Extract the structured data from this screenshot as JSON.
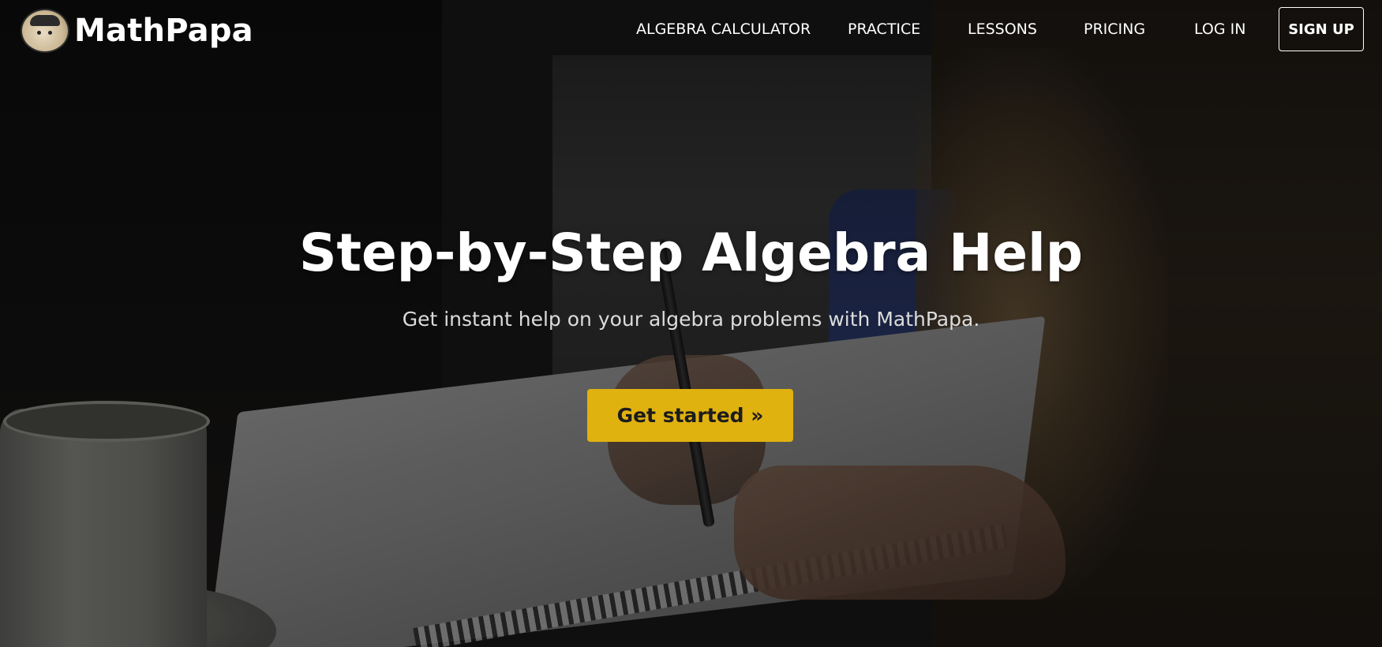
{
  "brand": {
    "name": "MathPapa",
    "logo_icon": "mathpapa-face-icon"
  },
  "nav": {
    "items": [
      {
        "label": "ALGEBRA CALCULATOR"
      },
      {
        "label": "PRACTICE"
      },
      {
        "label": "LESSONS"
      },
      {
        "label": "PRICING"
      },
      {
        "label": "LOG IN"
      }
    ],
    "signup_label": "SIGN UP"
  },
  "hero": {
    "title": "Step-by-Step Algebra Help",
    "subtitle": "Get instant help on your algebra problems with MathPapa.",
    "cta_label": "Get started »"
  },
  "colors": {
    "cta_background": "#e0b20f",
    "nav_text": "#ffffff",
    "overlay": "#0a0a0a"
  }
}
